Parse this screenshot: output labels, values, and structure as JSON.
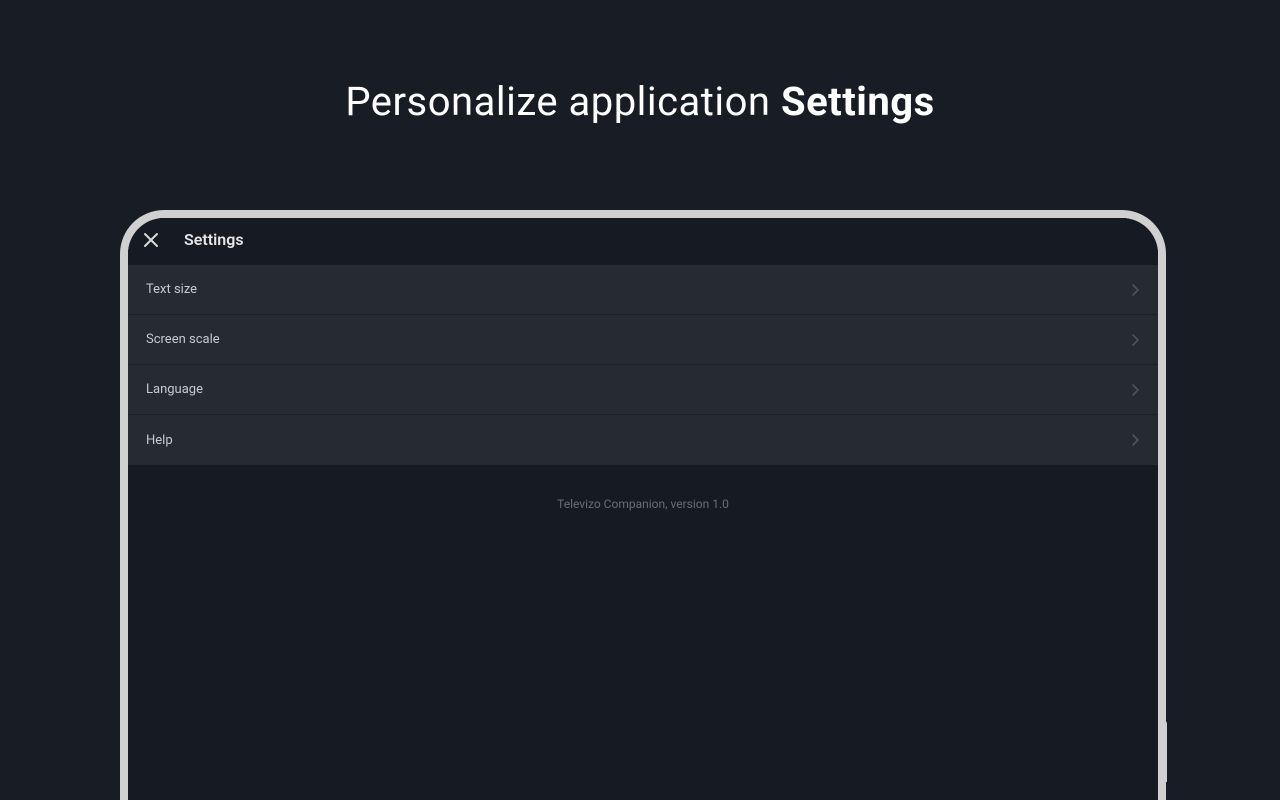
{
  "marketing": {
    "heading_prefix": "Personalize application ",
    "heading_bold": "Settings"
  },
  "app": {
    "header": {
      "title": "Settings"
    },
    "settings_items": [
      {
        "label": "Text size"
      },
      {
        "label": "Screen scale"
      },
      {
        "label": "Language"
      },
      {
        "label": "Help"
      }
    ],
    "version_text": "Televizo Companion, version 1.0"
  }
}
